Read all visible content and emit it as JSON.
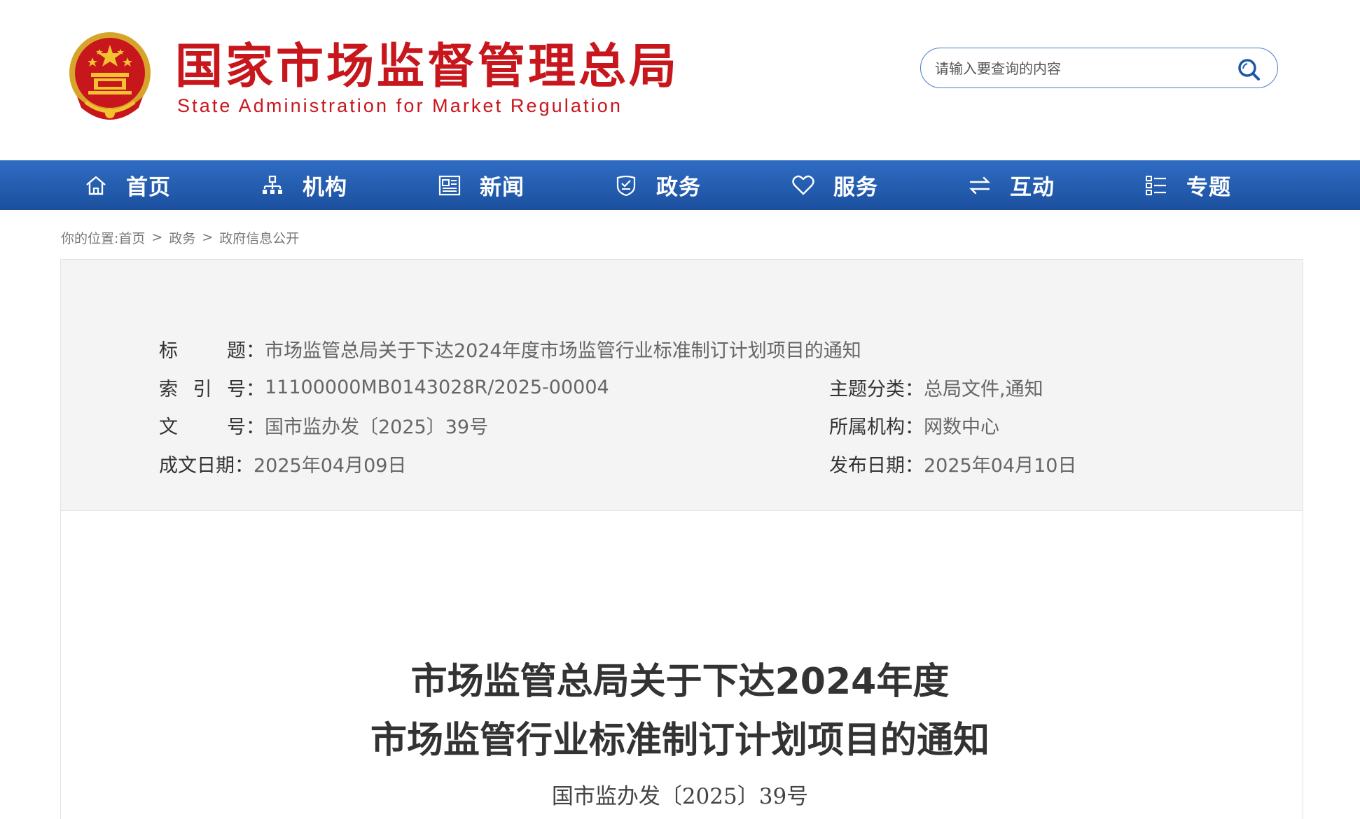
{
  "header": {
    "brand_cn": "国家市场监督管理总局",
    "brand_en": "State Administration for Market Regulation",
    "logo_icon": "national-emblem-icon",
    "search_placeholder": "请输入要查询的内容",
    "search_icon": "search-icon"
  },
  "nav": {
    "items": [
      {
        "label": "首页",
        "icon": "home-icon"
      },
      {
        "label": "机构",
        "icon": "org-chart-icon"
      },
      {
        "label": "新闻",
        "icon": "newspaper-icon"
      },
      {
        "label": "政务",
        "icon": "shield-icon"
      },
      {
        "label": "服务",
        "icon": "heart-icon"
      },
      {
        "label": "互动",
        "icon": "exchange-arrows-icon"
      },
      {
        "label": "专题",
        "icon": "list-icon"
      }
    ]
  },
  "breadcrumb": {
    "prefix": "你的位置:",
    "items": [
      "首页",
      "政务",
      "政府信息公开"
    ],
    "separator": ">"
  },
  "info": {
    "title_label": "标题",
    "title_value": "市场监管总局关于下达2024年度市场监管行业标准制订计划项目的通知",
    "index_label": "索引号",
    "index_value": "11100000MB0143028R/2025-00004",
    "category_label": "主题分类",
    "category_value": "总局文件,通知",
    "docno_label": "文号",
    "docno_value": "国市监办发〔2025〕39号",
    "org_label": "所属机构",
    "org_value": "网数中心",
    "created_label": "成文日期",
    "created_value": "2025年04月09日",
    "published_label": "发布日期",
    "published_value": "2025年04月10日",
    "colon": "："
  },
  "document": {
    "title_line1": "市场监管总局关于下达2024年度",
    "title_line2": "市场监管行业标准制订计划项目的通知",
    "number": "国市监办发〔2025〕39号"
  },
  "colors": {
    "brand_red": "#c8161d",
    "nav_blue_top": "#2f6dc3",
    "nav_blue_bottom": "#1b4f9e",
    "search_border": "#4a7ec4",
    "panel_bg": "#f4f4f4"
  }
}
